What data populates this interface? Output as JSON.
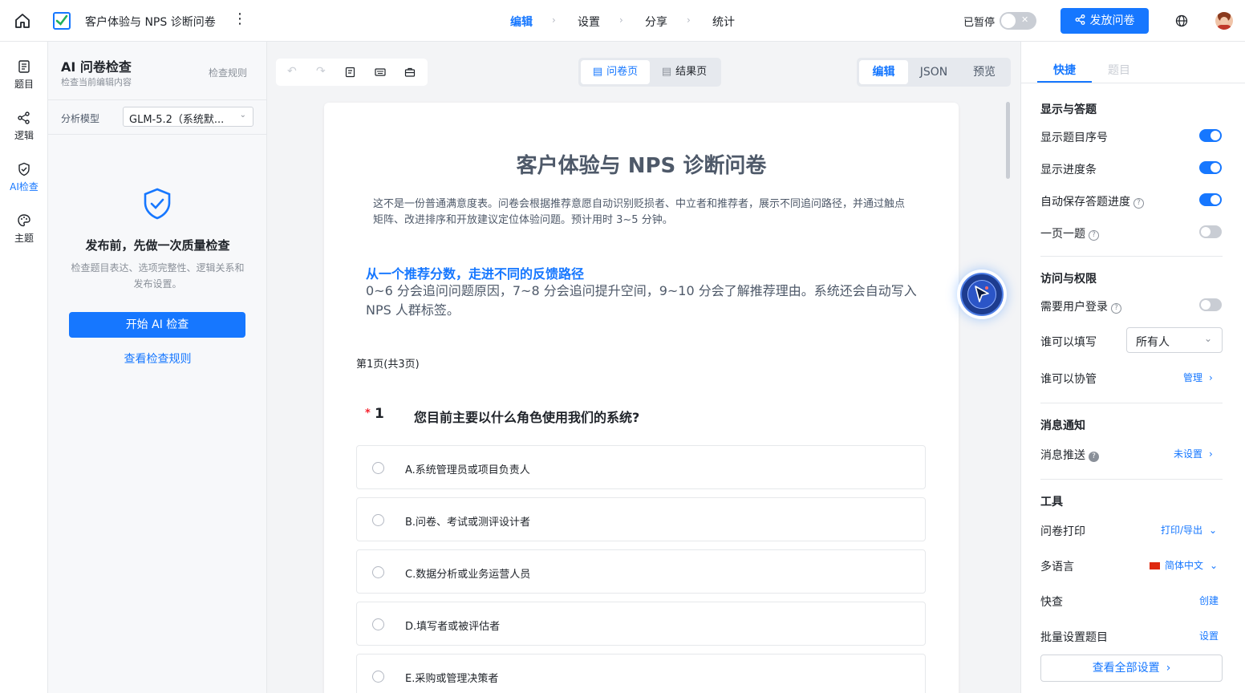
{
  "header": {
    "title": "客户体验与 NPS 诊断问卷",
    "tabs": [
      "编辑",
      "设置",
      "分享",
      "统计"
    ],
    "paused_label": "已暂停",
    "publish_label": "发放问卷"
  },
  "leftnav": {
    "items": [
      {
        "label": "题目",
        "icon": "list-icon"
      },
      {
        "label": "逻辑",
        "icon": "logic-icon"
      },
      {
        "label": "AI检查",
        "icon": "shield-check-icon"
      },
      {
        "label": "主题",
        "icon": "palette-icon"
      }
    ]
  },
  "ai_panel": {
    "title": "AI 问卷检查",
    "subtitle": "检查当前编辑内容",
    "rules_link": "检查规则",
    "model_label": "分析模型",
    "model_value": "GLM-5.2（系统默...",
    "empty_title": "发布前，先做一次质量检查",
    "empty_desc": "检查题目表达、选项完整性、逻辑关系和发布设置。",
    "start_button": "开始 AI 检查",
    "view_rules": "查看检查规则"
  },
  "toolbar": {
    "page_tabs": [
      "问卷页",
      "结果页"
    ],
    "mode_tabs": [
      "编辑",
      "JSON",
      "预览"
    ]
  },
  "survey": {
    "title": "客户体验与 NPS 诊断问卷",
    "desc": "这不是一份普通满意度表。问卷会根据推荐意愿自动识别贬损者、中立者和推荐者，展示不同追问路径，并通过触点矩阵、改进排序和开放建议定位体验问题。预计用时 3~5 分钟。",
    "section_title": "从一个推荐分数，走进不同的反馈路径",
    "section_desc": "0~6 分会追问问题原因，7~8 分会追问提升空间，9~10 分会了解推荐理由。系统还会自动写入 NPS 人群标签。",
    "page_indicator": "第1页(共3页)",
    "q1": {
      "required": "*",
      "number": "1",
      "text": "您目前主要以什么角色使用我们的系统?",
      "options": [
        "A.系统管理员或项目负责人",
        "B.问卷、考试或测评设计者",
        "C.数据分析或业务运营人员",
        "D.填写者或被评估者",
        "E.采购或管理决策者"
      ]
    }
  },
  "right_panel": {
    "tabs": [
      "快捷",
      "题目"
    ],
    "display": {
      "title": "显示与答题",
      "show_number": "显示题目序号",
      "show_progress": "显示进度条",
      "autosave": "自动保存答题进度",
      "one_per_page": "一页一题",
      "show_number_on": true,
      "show_progress_on": true,
      "autosave_on": true,
      "one_per_page_on": false
    },
    "access": {
      "title": "访问与权限",
      "login_required": "需要用户登录",
      "login_required_on": false,
      "who_fill": "谁可以填写",
      "who_fill_value": "所有人",
      "who_collab": "谁可以协管",
      "manage": "管理"
    },
    "notify": {
      "title": "消息通知",
      "push": "消息推送",
      "push_value": "未设置"
    },
    "tools": {
      "title": "工具",
      "print": "问卷打印",
      "print_value": "打印/导出",
      "lang": "多语言",
      "lang_value": "简体中文",
      "quick_check": "快查",
      "quick_check_value": "创建",
      "batch": "批量设置题目",
      "batch_value": "设置",
      "view_all": "查看全部设置"
    }
  },
  "colors": {
    "accent": "#1677ff",
    "danger": "#f5222d"
  }
}
